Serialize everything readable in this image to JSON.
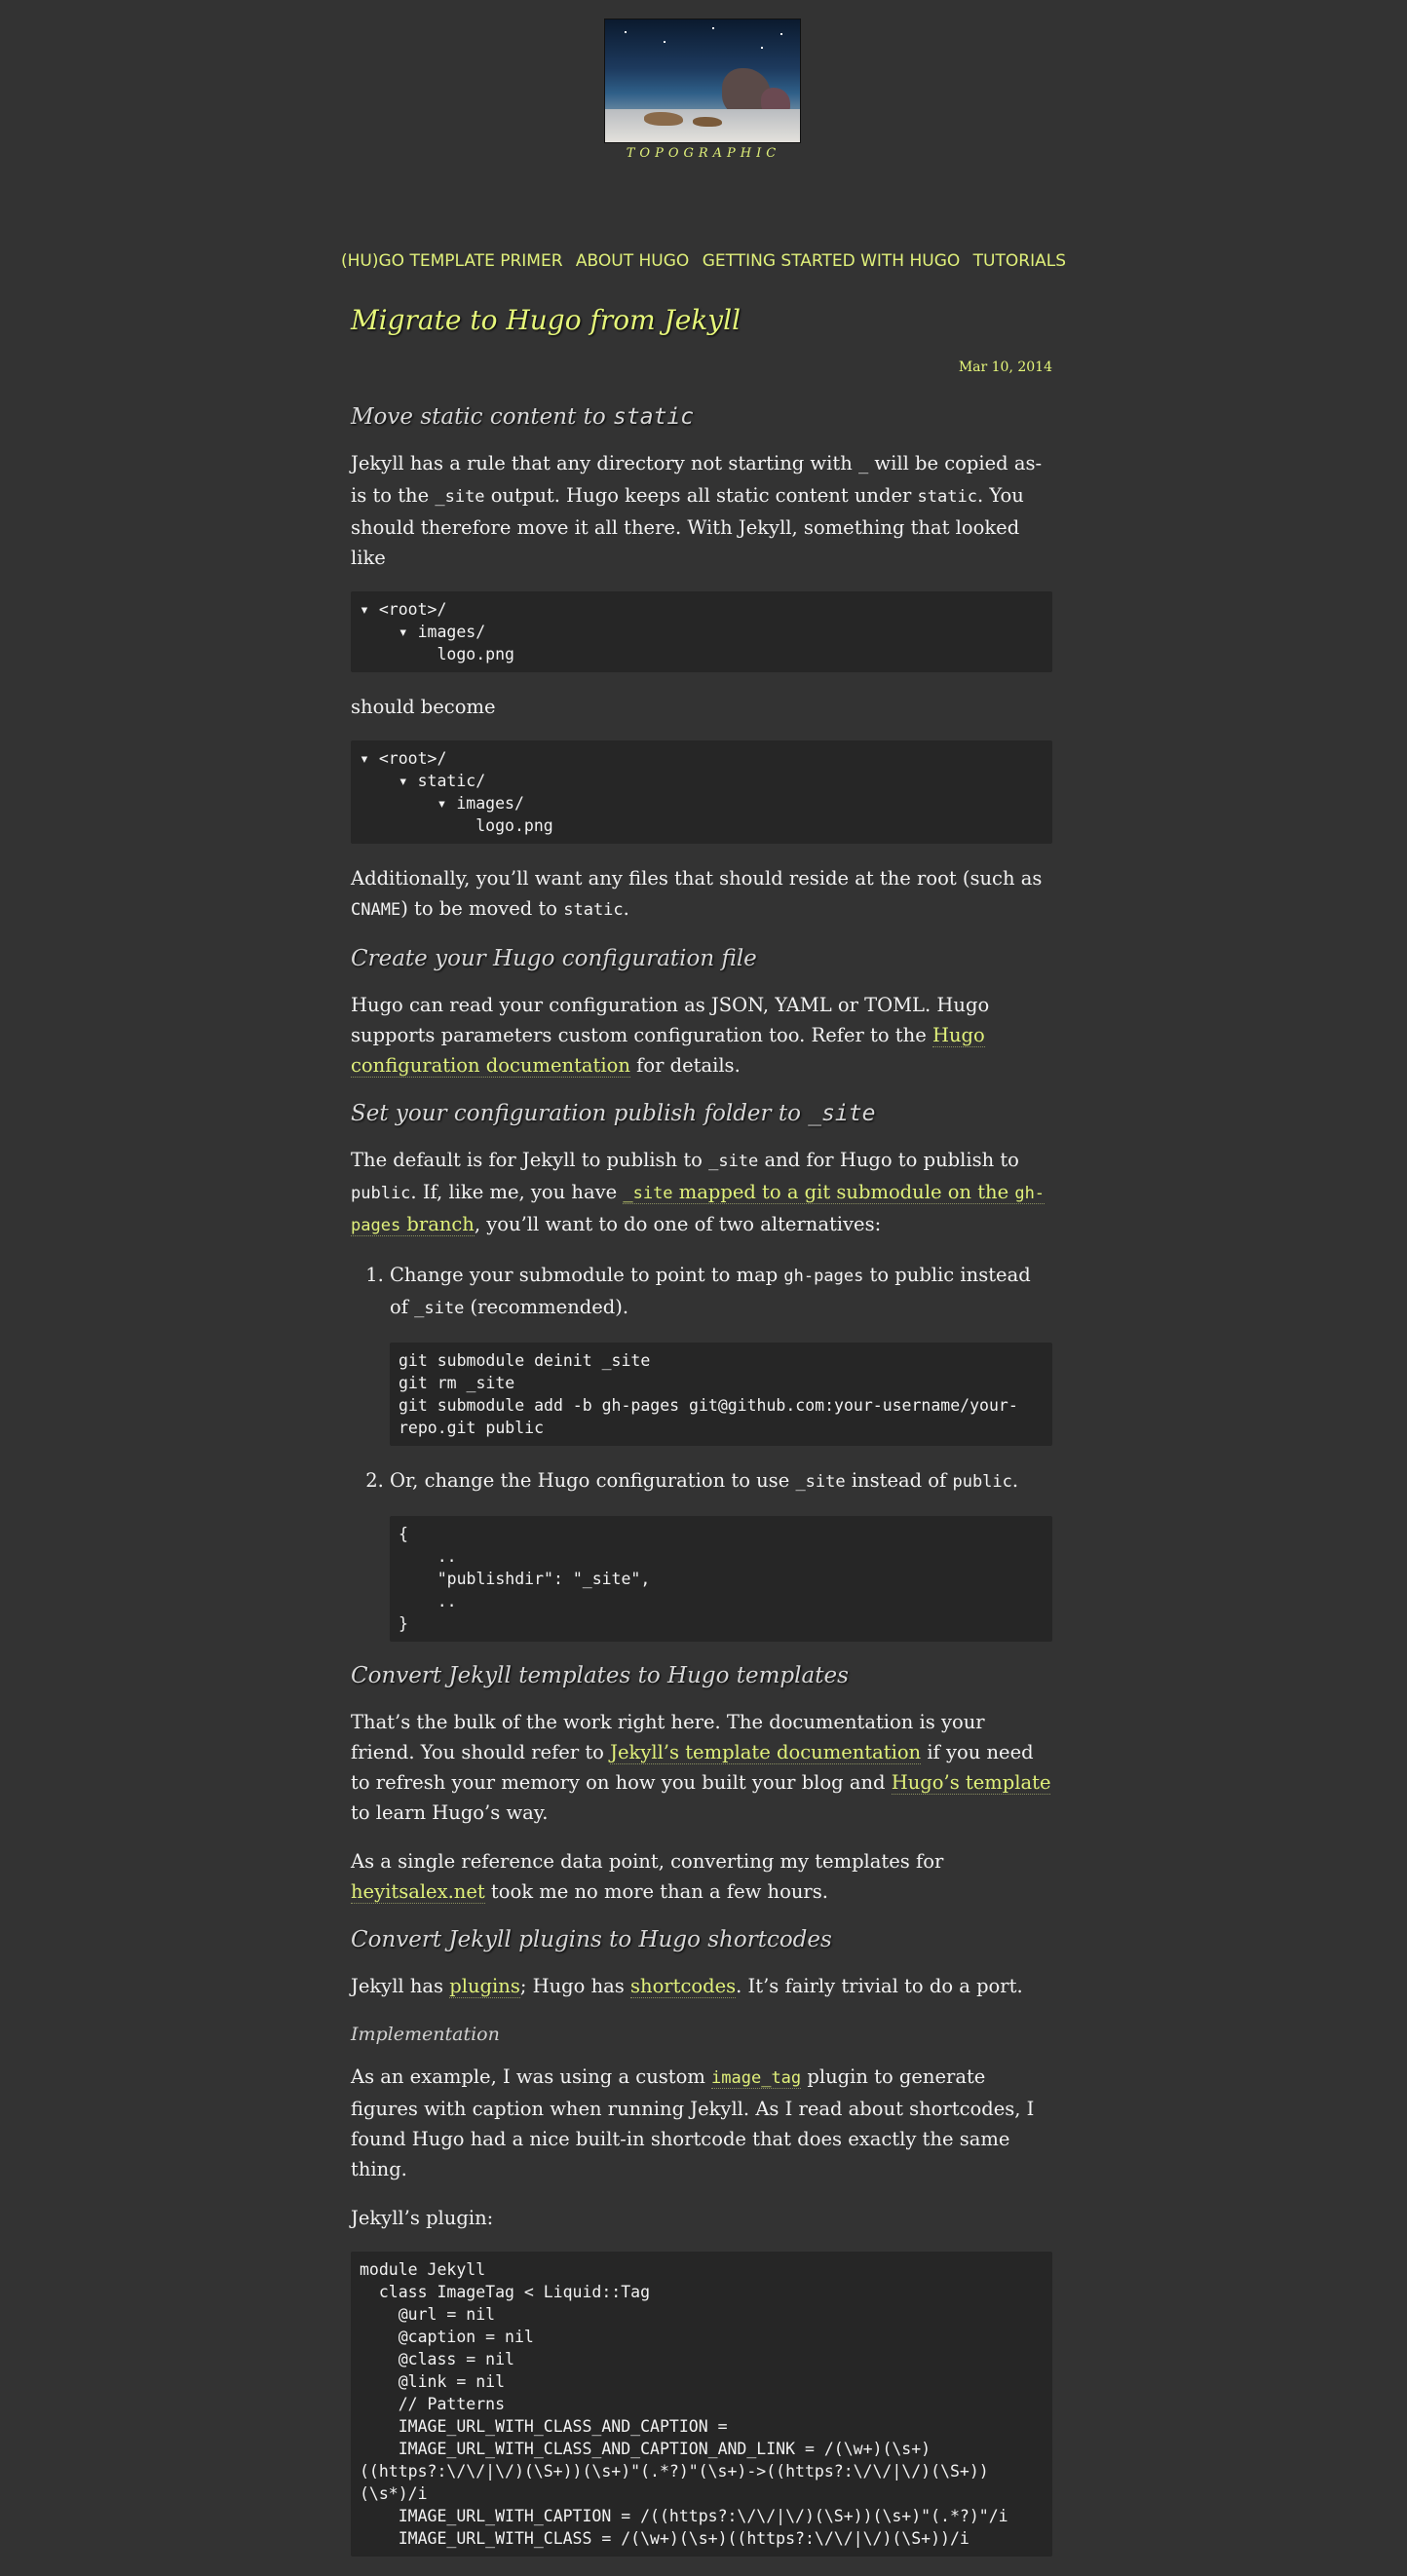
{
  "site": {
    "brand": "TOPOGRAPHIC"
  },
  "nav": [
    "(HU)GO TEMPLATE PRIMER",
    "ABOUT HUGO",
    "GETTING STARTED WITH HUGO",
    "TUTORIALS"
  ],
  "post": {
    "title": "Migrate to Hugo from Jekyll",
    "date": "Mar 10, 2014"
  },
  "s1": {
    "h_pre": "Move static content to ",
    "h_code": "static",
    "p1": [
      "Jekyll has a rule that any directory not starting with ",
      "_",
      " will be copied as-is to the ",
      "_site",
      " output. Hugo keeps all static content under ",
      "static",
      ". You should therefore move it all there. With Jekyll, something that looked like"
    ],
    "pre1": "▾ <root>/\n    ▾ images/\n        logo.png",
    "p2": "should become",
    "pre2": "▾ <root>/\n    ▾ static/\n        ▾ images/\n            logo.png",
    "p3": [
      "Additionally, you’ll want any files that should reside at the root (such as ",
      "CNAME",
      ") to be moved to ",
      "static",
      "."
    ]
  },
  "s2": {
    "h": "Create your Hugo configuration file",
    "p": [
      "Hugo can read your configuration as JSON, YAML or TOML. Hugo supports parameters custom configuration too. Refer to the ",
      "Hugo configuration documentation",
      " for details."
    ]
  },
  "s3": {
    "h_pre": "Set your configuration publish folder to ",
    "h_code": "_site",
    "p": [
      "The default is for Jekyll to publish to ",
      "_site",
      " and for Hugo to publish to ",
      "public",
      ". If, like me, you have ",
      "_site",
      " mapped to a git submodule on the ",
      "gh-pages",
      " branch",
      ", you’ll want to do one of two alternatives:"
    ],
    "li1": [
      "Change your submodule to point to map ",
      "gh-pages",
      " to public instead of ",
      "_site",
      " (recommended)."
    ],
    "li1_pre": "git submodule deinit _site\ngit rm _site\ngit submodule add -b gh-pages git@github.com:your-username/your-repo.git public",
    "li2": [
      "Or, change the Hugo configuration to use ",
      "_site",
      " instead of ",
      "public",
      "."
    ],
    "li2_pre": "{\n    ..\n    \"publishdir\": \"_site\",\n    ..\n}"
  },
  "s4": {
    "h": "Convert Jekyll templates to Hugo templates",
    "p1": [
      "That’s the bulk of the work right here. The documentation is your friend. You should refer to ",
      "Jekyll’s template documentation",
      " if you need to refresh your memory on how you built your blog and ",
      "Hugo’s template",
      " to learn Hugo’s way."
    ],
    "p2": [
      "As a single reference data point, converting my templates for ",
      "heyitsalex.net",
      " took me no more than a few hours."
    ]
  },
  "s5": {
    "h": "Convert Jekyll plugins to Hugo shortcodes",
    "p1": [
      "Jekyll has ",
      "plugins",
      "; Hugo has ",
      "shortcodes",
      ". It’s fairly trivial to do a port."
    ],
    "h3": "Implementation",
    "p2": [
      "As an example, I was using a custom ",
      "image_tag",
      " plugin to generate figures with caption when running Jekyll. As I read about shortcodes, I found Hugo had a nice built-in shortcode that does exactly the same thing."
    ],
    "p3": "Jekyll’s plugin:",
    "pre": "module Jekyll\n  class ImageTag < Liquid::Tag\n    @url = nil\n    @caption = nil\n    @class = nil\n    @link = nil\n    // Patterns\n    IMAGE_URL_WITH_CLASS_AND_CAPTION =\n    IMAGE_URL_WITH_CLASS_AND_CAPTION_AND_LINK = /(\\w+)(\\s+)((https?:\\/\\/|\\/)(\\S+))(\\s+)\"(.*?)\"(\\s+)->((https?:\\/\\/|\\/)(\\S+))(\\s*)/i\n    IMAGE_URL_WITH_CAPTION = /((https?:\\/\\/|\\/)(\\S+))(\\s+)\"(.*?)\"/i\n    IMAGE_URL_WITH_CLASS = /(\\w+)(\\s+)((https?:\\/\\/|\\/)(\\S+))/i"
  }
}
